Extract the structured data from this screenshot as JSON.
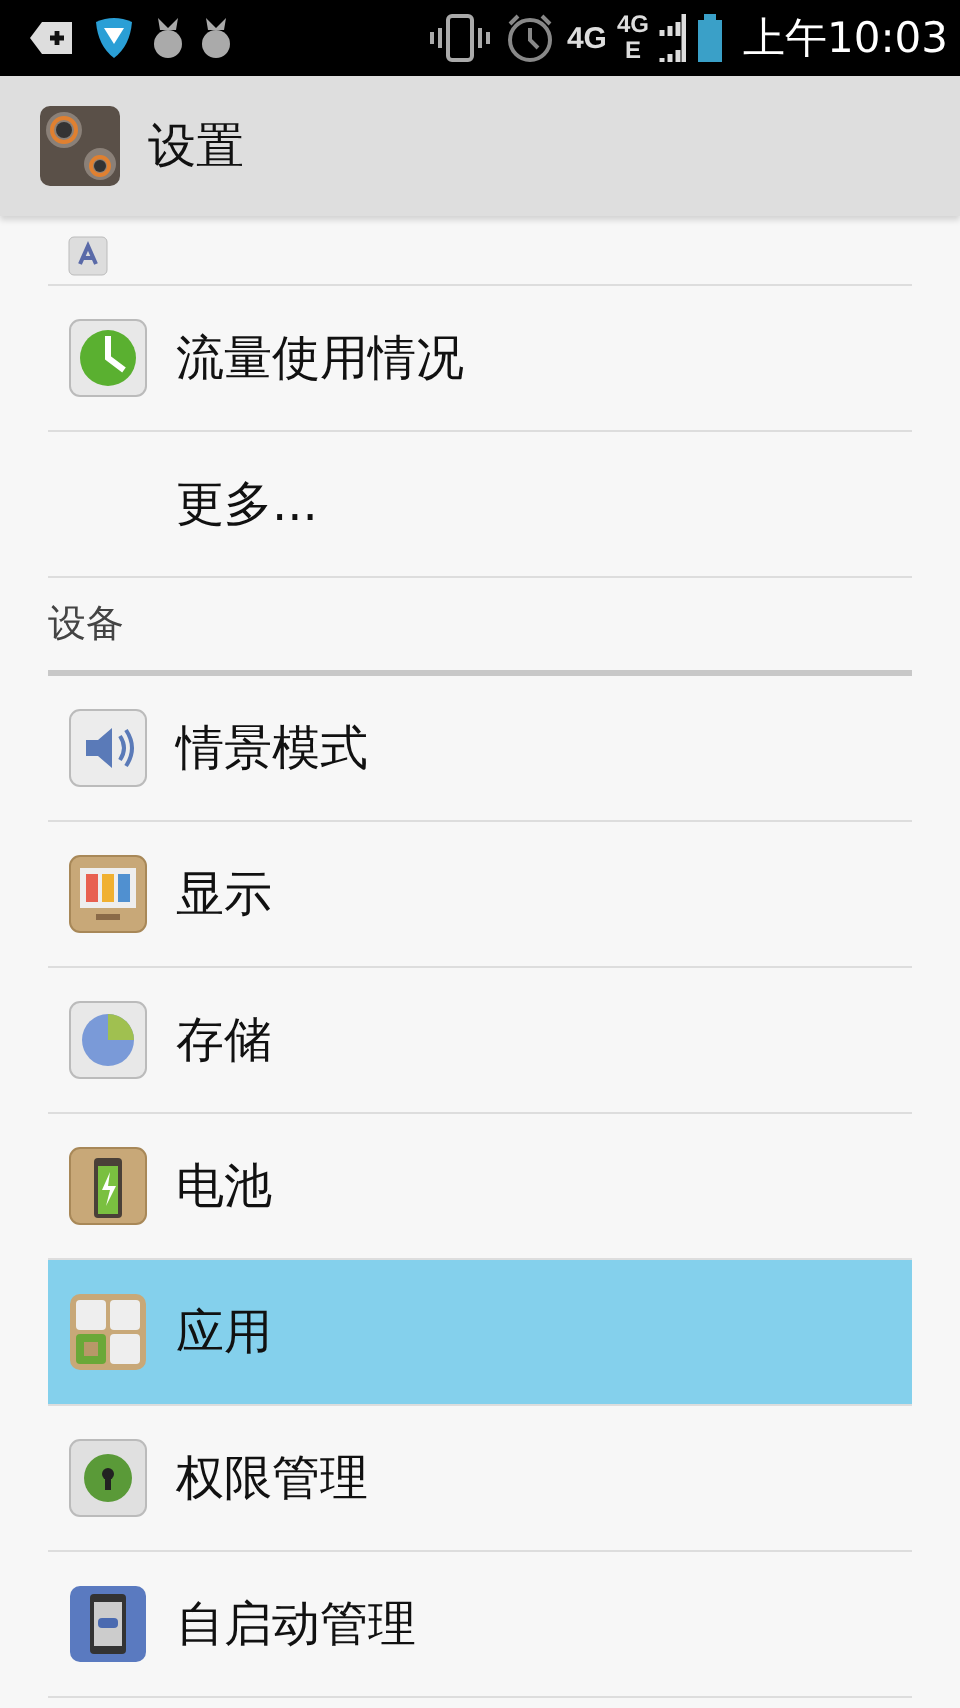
{
  "status_bar": {
    "network_labels": [
      "4G",
      "4G",
      "E"
    ],
    "time": "上午10:03"
  },
  "header": {
    "title": "设置"
  },
  "list": [
    {
      "kind": "cut-row"
    },
    {
      "kind": "icon-row",
      "label": "流量使用情况",
      "selected": false
    },
    {
      "kind": "text-row",
      "label": "更多...",
      "selected": false
    },
    {
      "kind": "section",
      "label": "设备"
    },
    {
      "kind": "icon-row",
      "label": "情景模式",
      "selected": false
    },
    {
      "kind": "icon-row",
      "label": "显示",
      "selected": false
    },
    {
      "kind": "icon-row",
      "label": "存储",
      "selected": false
    },
    {
      "kind": "icon-row",
      "label": "电池",
      "selected": false
    },
    {
      "kind": "icon-row",
      "label": "应用",
      "selected": true
    },
    {
      "kind": "icon-row",
      "label": "权限管理",
      "selected": false
    },
    {
      "kind": "icon-row",
      "label": "自启动管理",
      "selected": false
    }
  ]
}
